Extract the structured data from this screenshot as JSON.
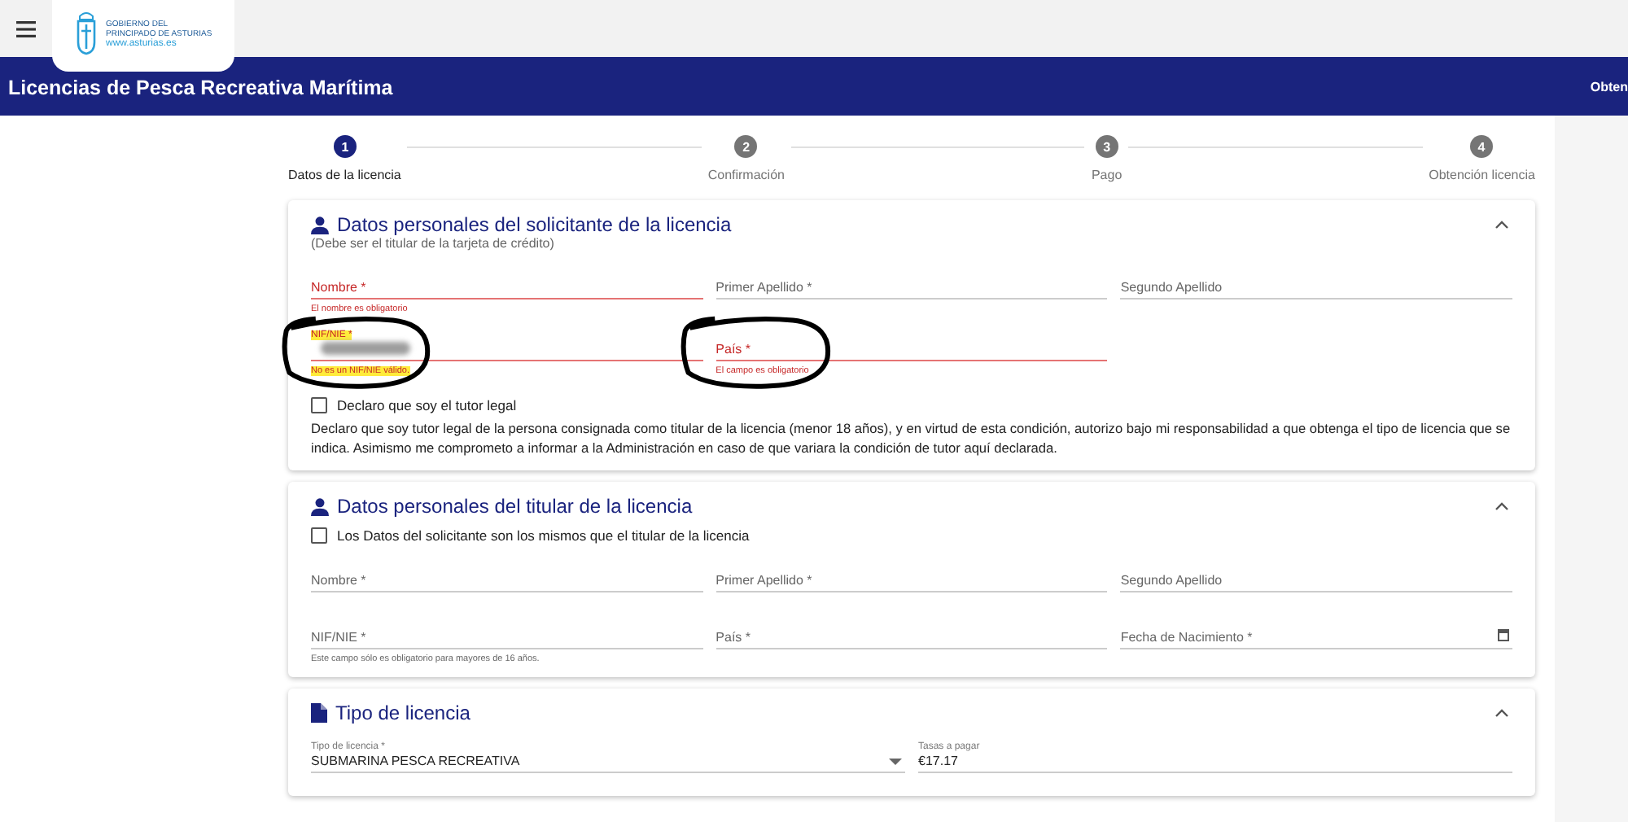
{
  "logo": {
    "lines": [
      "GOBIERNO DEL",
      "PRINCIPADO DE ASTURIAS"
    ],
    "url": "www.asturias.es"
  },
  "header": {
    "title": "Licencias de Pesca Recreativa Marítima",
    "right_text": "Obten"
  },
  "steps": [
    {
      "number": "1",
      "label": "Datos de la licencia",
      "selected": true
    },
    {
      "number": "2",
      "label": "Confirmación",
      "selected": false
    },
    {
      "number": "3",
      "label": "Pago",
      "selected": false
    },
    {
      "number": "4",
      "label": "Obtención licencia",
      "selected": false
    }
  ],
  "cards": [
    {
      "kind": "personal",
      "title": "Datos personales del solicitante de la licencia",
      "subtitle": "(Debe ser el titular de la tarjeta de crédito)",
      "expanded": true,
      "fields": [
        {
          "kind": "text",
          "label": "Nombre *",
          "invalid": true,
          "error": "El nombre es obligatorio"
        },
        {
          "kind": "text",
          "label": "Primer Apellido *",
          "invalid": false
        },
        {
          "kind": "text",
          "label": "Segundo Apellido",
          "invalid": false
        },
        {
          "kind": "redacted",
          "label": "NIF/NIE *",
          "floating": true,
          "invalid": true,
          "error": "No es un NIF/NIE válido.",
          "highlighted": true,
          "circled": true
        },
        {
          "kind": "text",
          "label": "País *",
          "invalid": true,
          "error": "El campo es obligatorio",
          "circled": true
        }
      ],
      "checkbox": {
        "label": "Declaro que soy el tutor legal",
        "checked": false
      },
      "paragraph": "Declaro que soy tutor legal de la persona consignada como titular de la licencia (menor 18 años), y en virtud de esta condición, autorizo bajo mi responsabilidad a que obtenga el tipo de licencia que se indica. Asimismo me comprometo a informar a la Administración en caso de que variara la condición de tutor aquí declarada."
    },
    {
      "kind": "personal",
      "title": "Datos personales del titular de la licencia",
      "expanded": true,
      "top_checkbox": {
        "label": "Los Datos del solicitante son los mismos que el titular de la licencia",
        "checked": false
      },
      "fields": [
        {
          "kind": "text",
          "label": "Nombre *",
          "invalid": false
        },
        {
          "kind": "text",
          "label": "Primer Apellido *",
          "invalid": false
        },
        {
          "kind": "text",
          "label": "Segundo Apellido",
          "invalid": false
        },
        {
          "kind": "text",
          "label": "NIF/NIE *",
          "invalid": false,
          "hint": "Este campo sólo es obligatorio para mayores de 16 años."
        },
        {
          "kind": "text",
          "label": "País *",
          "invalid": false
        },
        {
          "kind": "date",
          "label": "Fecha de Nacimiento *",
          "invalid": false
        }
      ]
    },
    {
      "kind": "license",
      "title": "Tipo de licencia",
      "expanded": true,
      "fields": [
        {
          "kind": "select",
          "label": "Tipo de licencia *",
          "floating": true,
          "value": "SUBMARINA PESCA RECREATIVA",
          "invalid": false
        },
        {
          "kind": "text",
          "label": "Tasas a pagar",
          "floating": true,
          "value": "€17.17",
          "invalid": false
        }
      ]
    }
  ]
}
